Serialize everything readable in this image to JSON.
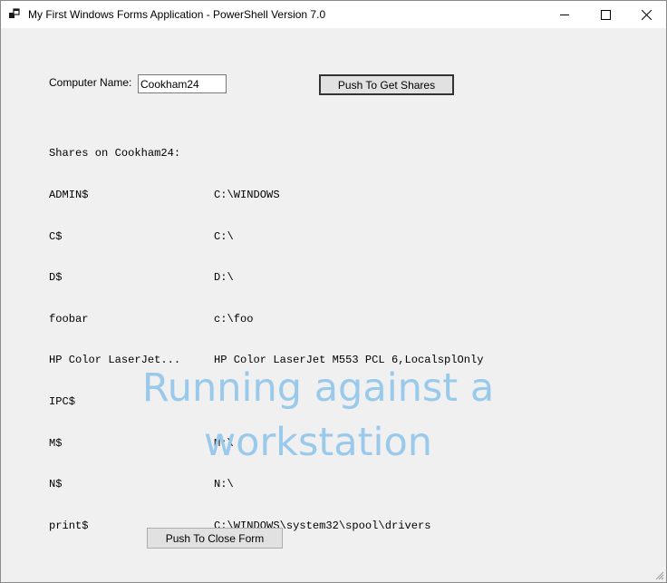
{
  "window": {
    "title": "My First Windows Forms Application - PowerShell Version 7.0",
    "controls": [
      "minimize-icon",
      "maximize-icon",
      "close-icon"
    ]
  },
  "form": {
    "computer_name_label": "Computer Name:",
    "computer_name_value": "Cookham24",
    "get_shares_button": "Push To Get Shares",
    "close_form_button": "Push To Close Form"
  },
  "output": {
    "header": "Shares on Cookham24:",
    "shares": [
      {
        "name": "ADMIN$",
        "path": "C:\\WINDOWS"
      },
      {
        "name": "C$",
        "path": "C:\\"
      },
      {
        "name": "D$",
        "path": "D:\\"
      },
      {
        "name": "foobar",
        "path": "c:\\foo"
      },
      {
        "name": "HP Color LaserJet...",
        "path": "HP Color LaserJet M553 PCL 6,LocalsplOnly"
      },
      {
        "name": "IPC$",
        "path": ""
      },
      {
        "name": "M$",
        "path": "M:\\"
      },
      {
        "name": "N$",
        "path": "N:\\"
      },
      {
        "name": "print$",
        "path": "C:\\WINDOWS\\system32\\spool\\drivers"
      }
    ]
  },
  "banner": {
    "line1": "Running against a",
    "line2": "workstation",
    "color": "#99c9eb"
  }
}
